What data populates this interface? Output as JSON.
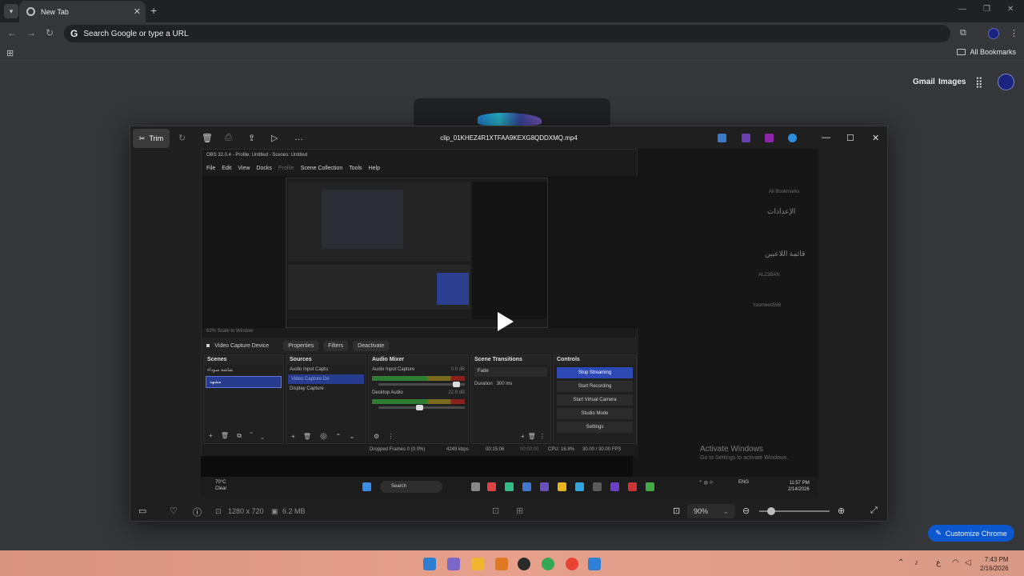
{
  "chrome": {
    "tab_title": "New Tab",
    "omnibox_placeholder": "Search Google or type a URL",
    "all_bookmarks": "All Bookmarks"
  },
  "ntp": {
    "gmail": "Gmail",
    "images": "Images",
    "customize": "Customize Chrome"
  },
  "viewer": {
    "trim_label": "Trim",
    "filename": "clip_01KHEZ4R1XTFAA9KEXG8QDDXMQ.mp4",
    "resolution": "1280 x 720",
    "filesize": "6.2 MB",
    "zoom": "90%"
  },
  "obs": {
    "title": "OBS 32.0.4 - Profile: Untitled - Scenes: Untitled",
    "menu": [
      "File",
      "Edit",
      "View",
      "Docks",
      "Profile",
      "Scene Collection",
      "Tools",
      "Help"
    ],
    "zoom_text": "62%   Scale to Window",
    "source_label": "Video Capture Device",
    "properties": "Properties",
    "filters": "Filters",
    "deactivate": "Deactivate",
    "scenes_header": "Scenes",
    "scenes": [
      "شاشة سوداء",
      "مشهد"
    ],
    "sources_header": "Sources",
    "sources": [
      "Audio Input Captu",
      "Video Capture De",
      "Display Capture"
    ],
    "mixer_header": "Audio Mixer",
    "mixer": [
      {
        "name": "Audio Input Capture",
        "db": "0.0 dB"
      },
      {
        "name": "Desktop Audio",
        "db": "22.9 dB"
      }
    ],
    "transitions_header": "Scene Transitions",
    "transition": "Fade",
    "duration_label": "Duration",
    "duration_value": "300 ms",
    "controls_header": "Controls",
    "controls": [
      "Stop Streaming",
      "Start Recording",
      "Start Virtual Camera",
      "Studio Mode",
      "Settings"
    ],
    "status": {
      "dropped": "Dropped Frames 0 (0.0%)",
      "kbps": "4249 kbps",
      "time1": "00:15:06",
      "time2": "00:00:00",
      "cpu": "CPU: 16.8%",
      "fps": "30.00 / 30.00 FPS"
    }
  },
  "background_app": {
    "settings_title": "الإعدادات",
    "players_title": "قائمة اللاعبين",
    "player1": "ALZ3BAN",
    "player2": "Yasmeen598",
    "bookmarks": "All Bookmarks",
    "activate_title": "Activate Windows",
    "activate_sub": "Go to Settings to activate Windows."
  },
  "inner_taskbar": {
    "temp": "70°C",
    "weather": "Clear",
    "search": "Search",
    "lang": "ENG",
    "time": "11:57 PM",
    "date": "2/14/2026"
  },
  "taskbar": {
    "time": "7:43 PM",
    "date": "2/16/2026"
  },
  "colors": {
    "accent": "#0b57d0",
    "obs_stream": "#2c49b4",
    "taskbar": "#e6a08c"
  }
}
